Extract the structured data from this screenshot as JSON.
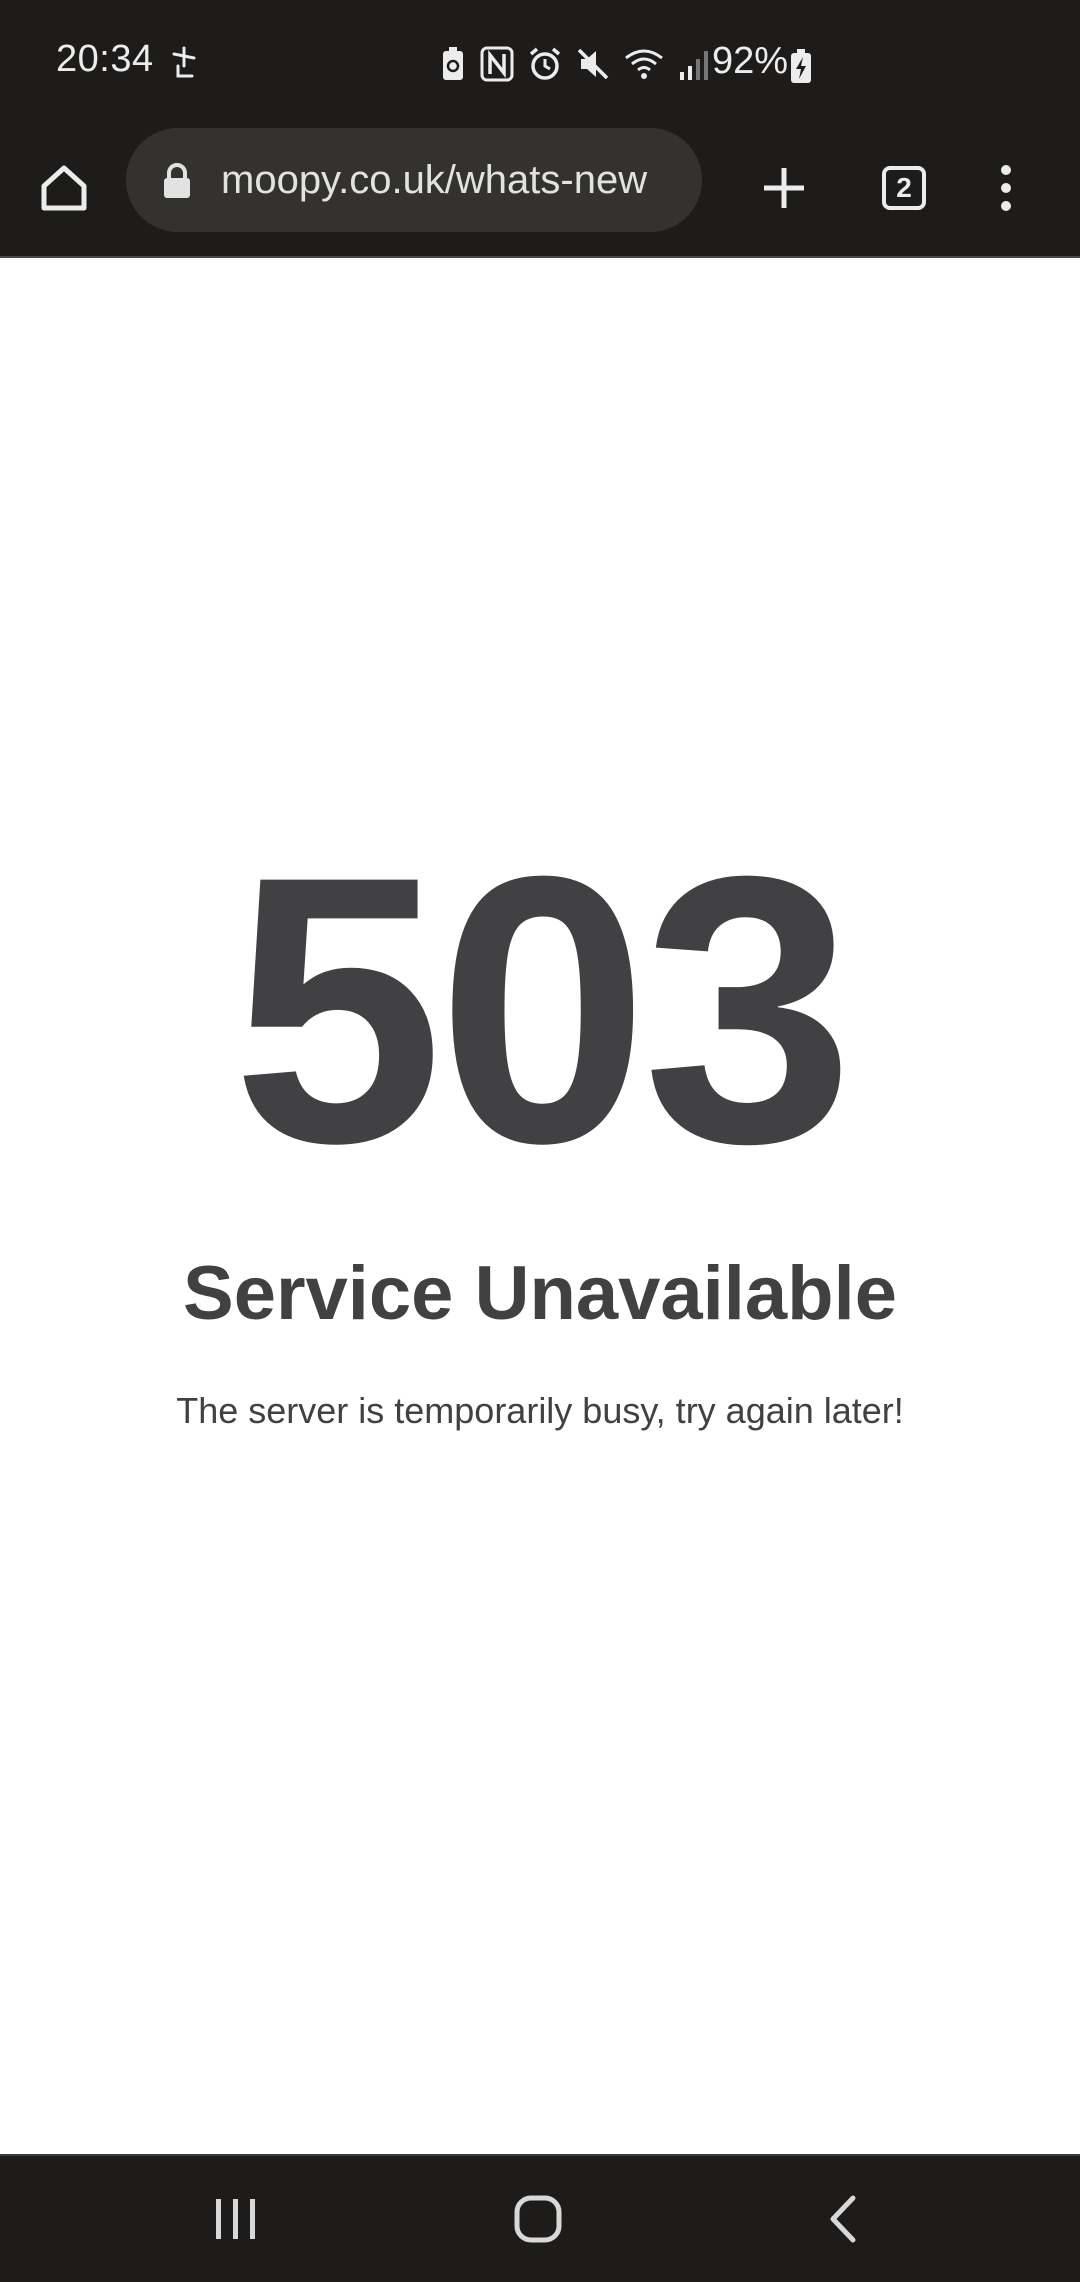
{
  "status_bar": {
    "time": "20:34",
    "battery_percent": "92%",
    "icons": [
      "pinwheel-icon",
      "battery-saver-icon",
      "nfc-icon",
      "alarm-icon",
      "mute-icon",
      "wifi-icon",
      "signal-icon",
      "battery-charging-icon"
    ]
  },
  "browser": {
    "url": "moopy.co.uk/whats-new",
    "tab_count": "2",
    "buttons": [
      "home-icon",
      "lock-icon",
      "plus-icon",
      "tabs-icon",
      "more-vert-icon"
    ]
  },
  "page": {
    "error_code": "503",
    "title": "Service Unavailable",
    "message": "The server is temporarily busy, try again later!"
  },
  "nav_bar": {
    "buttons": [
      "recents-icon",
      "home-icon",
      "back-icon"
    ]
  },
  "colors": {
    "chrome_bg": "#1d1c1a",
    "url_bar_bg": "#33322e",
    "text_dark": "#414143",
    "page_bg": "#ffffff"
  }
}
